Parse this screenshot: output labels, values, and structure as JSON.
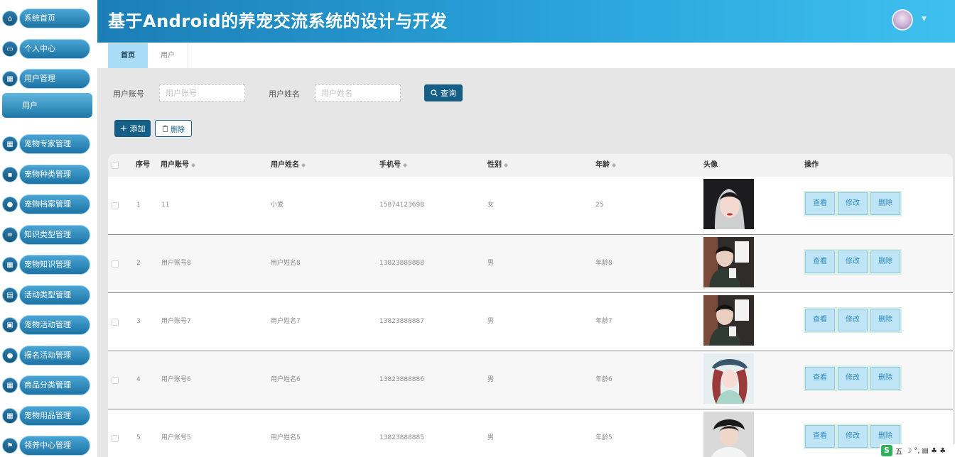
{
  "header": {
    "title": "基于Android的养宠交流系统的设计与开发",
    "dropdown_caret": "▼"
  },
  "sidebar": {
    "items": [
      {
        "label": "系统首页",
        "icon": "home-icon",
        "glyph": "⌂"
      },
      {
        "label": "个人中心",
        "icon": "profile-card-icon",
        "glyph": "▭"
      },
      {
        "label": "用户管理",
        "icon": "grid-icon",
        "glyph": "▦"
      },
      {
        "label": "宠物专家管理",
        "icon": "grid-icon",
        "glyph": "▦"
      },
      {
        "label": "宠物种类管理",
        "icon": "chat-icon",
        "glyph": "▪"
      },
      {
        "label": "宠物档案管理",
        "icon": "person-icon",
        "glyph": "●"
      },
      {
        "label": "知识类型管理",
        "icon": "sliders-icon",
        "glyph": "≡"
      },
      {
        "label": "宠物知识管理",
        "icon": "grid-icon",
        "glyph": "▦"
      },
      {
        "label": "活动类型管理",
        "icon": "clipboard-icon",
        "glyph": "▤"
      },
      {
        "label": "宠物活动管理",
        "icon": "calendar-icon",
        "glyph": "▣"
      },
      {
        "label": "报名活动管理",
        "icon": "location-pin-icon",
        "glyph": "●"
      },
      {
        "label": "商品分类管理",
        "icon": "table-icon",
        "glyph": "▦"
      },
      {
        "label": "宠物用品管理",
        "icon": "grid-icon",
        "glyph": "▦"
      },
      {
        "label": "领养中心管理",
        "icon": "flag-icon",
        "glyph": "⚑"
      }
    ],
    "sub_item": "用户"
  },
  "tabs": [
    {
      "label": "首页",
      "active": true
    },
    {
      "label": "用户",
      "active": false
    }
  ],
  "search": {
    "account_label": "用户账号",
    "account_placeholder": "用户账号",
    "name_label": "用户姓名",
    "name_placeholder": "用户姓名",
    "query_label": "查询"
  },
  "actions": {
    "add_label": "添加",
    "delete_label": "删除"
  },
  "table": {
    "columns": {
      "index": "序号",
      "account": "用户账号",
      "name": "用户姓名",
      "phone": "手机号",
      "gender": "性别",
      "age": "年龄",
      "avatar": "头像",
      "ops": "操作"
    },
    "sort_glyph": "◆",
    "op_labels": {
      "view": "查看",
      "edit": "修改",
      "delete": "删除"
    },
    "rows": [
      {
        "index": "1",
        "account": "11",
        "name": "小爱",
        "phone": "15874123698",
        "gender": "女",
        "age": "25"
      },
      {
        "index": "2",
        "account": "用户账号8",
        "name": "用户姓名8",
        "phone": "13823888888",
        "gender": "男",
        "age": "年龄8"
      },
      {
        "index": "3",
        "account": "用户账号7",
        "name": "用户姓名7",
        "phone": "13823888887",
        "gender": "男",
        "age": "年龄7"
      },
      {
        "index": "4",
        "account": "用户账号6",
        "name": "用户姓名6",
        "phone": "13823888886",
        "gender": "男",
        "age": "年龄6"
      },
      {
        "index": "5",
        "account": "用户账号5",
        "name": "用户姓名5",
        "phone": "13823888885",
        "gender": "男",
        "age": "年龄5"
      }
    ]
  },
  "taskbar": {
    "ime_logo": "S",
    "ime_mode": "五",
    "icons": "☽ °, ▤ ♣ ♣"
  },
  "colors": {
    "header_start": "#1c7eb6",
    "header_end": "#3ec0ee",
    "primary_button": "#155f86",
    "active_tab": "#a9dcf7",
    "op_button": "#bfe4f5"
  }
}
